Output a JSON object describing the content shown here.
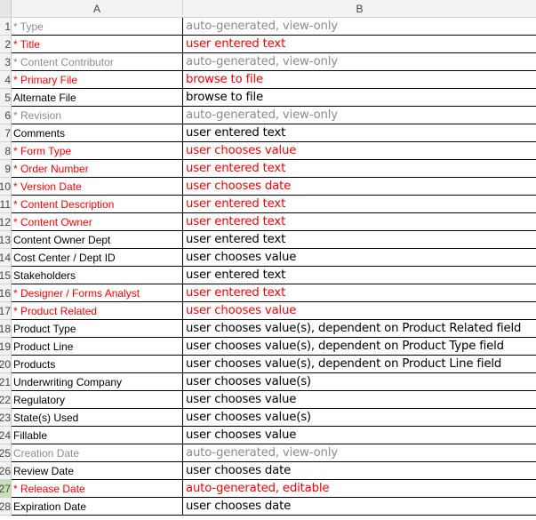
{
  "columns": {
    "a": "A",
    "b": "B"
  },
  "colors": {
    "required": "#ff0000",
    "readonly": "#8c8c8c",
    "normal": "#000000"
  },
  "rows": [
    {
      "num": "1",
      "field": "* Type",
      "value": "auto-generated, view-only",
      "style": "gray"
    },
    {
      "num": "2",
      "field": "* Title",
      "value": "user entered text",
      "style": "red"
    },
    {
      "num": "3",
      "field": "* Content Contributor",
      "value": "auto-generated, view-only",
      "style": "gray"
    },
    {
      "num": "4",
      "field": "* Primary File",
      "value": "browse to file",
      "style": "red"
    },
    {
      "num": "5",
      "field": "Alternate File",
      "value": "browse to file",
      "style": "black"
    },
    {
      "num": "6",
      "field": "* Revision",
      "value": "auto-generated, view-only",
      "style": "gray"
    },
    {
      "num": "7",
      "field": "Comments",
      "value": "user entered text",
      "style": "black"
    },
    {
      "num": "8",
      "field": "* Form Type",
      "value": "user chooses value",
      "style": "red"
    },
    {
      "num": "9",
      "field": "* Order Number",
      "value": "user entered text",
      "style": "red"
    },
    {
      "num": "10",
      "field": "* Version Date",
      "value": "user chooses date",
      "style": "red"
    },
    {
      "num": "11",
      "field": "* Content Description",
      "value": "user entered text",
      "style": "red"
    },
    {
      "num": "12",
      "field": "* Content Owner",
      "value": "user entered text",
      "style": "red"
    },
    {
      "num": "13",
      "field": "Content Owner Dept",
      "value": "user entered text",
      "style": "black"
    },
    {
      "num": "14",
      "field": "Cost Center / Dept ID",
      "value": "user chooses value",
      "style": "black"
    },
    {
      "num": "15",
      "field": "Stakeholders",
      "value": "user entered text",
      "style": "black"
    },
    {
      "num": "16",
      "field": "* Designer / Forms Analyst",
      "value": "user entered text",
      "style": "red"
    },
    {
      "num": "17",
      "field": "* Product Related",
      "value": "user chooses value",
      "style": "red"
    },
    {
      "num": "18",
      "field": "Product Type",
      "value": "user chooses value(s), dependent on Product Related field",
      "style": "black"
    },
    {
      "num": "19",
      "field": "Product Line",
      "value": "user chooses value(s), dependent on Product Type field",
      "style": "black"
    },
    {
      "num": "20",
      "field": "Products",
      "value": "user chooses value(s), dependent on Product Line field",
      "style": "black"
    },
    {
      "num": "21",
      "field": "Underwriting Company",
      "value": "user chooses value(s)",
      "style": "black"
    },
    {
      "num": "22",
      "field": "Regulatory",
      "value": "user chooses value",
      "style": "black"
    },
    {
      "num": "23",
      "field": "State(s) Used",
      "value": "user chooses value(s)",
      "style": "black"
    },
    {
      "num": "24",
      "field": "Fillable",
      "value": "user chooses value",
      "style": "black"
    },
    {
      "num": "25",
      "field": "Creation Date",
      "value": "auto-generated, view-only",
      "style": "gray"
    },
    {
      "num": "26",
      "field": "Review Date",
      "value": "user chooses date",
      "style": "black"
    },
    {
      "num": "27",
      "field": "* Release Date",
      "value": "auto-generated, editable",
      "style": "red",
      "selected": true
    },
    {
      "num": "28",
      "field": "Expiration Date",
      "value": "user chooses date",
      "style": "black"
    }
  ]
}
